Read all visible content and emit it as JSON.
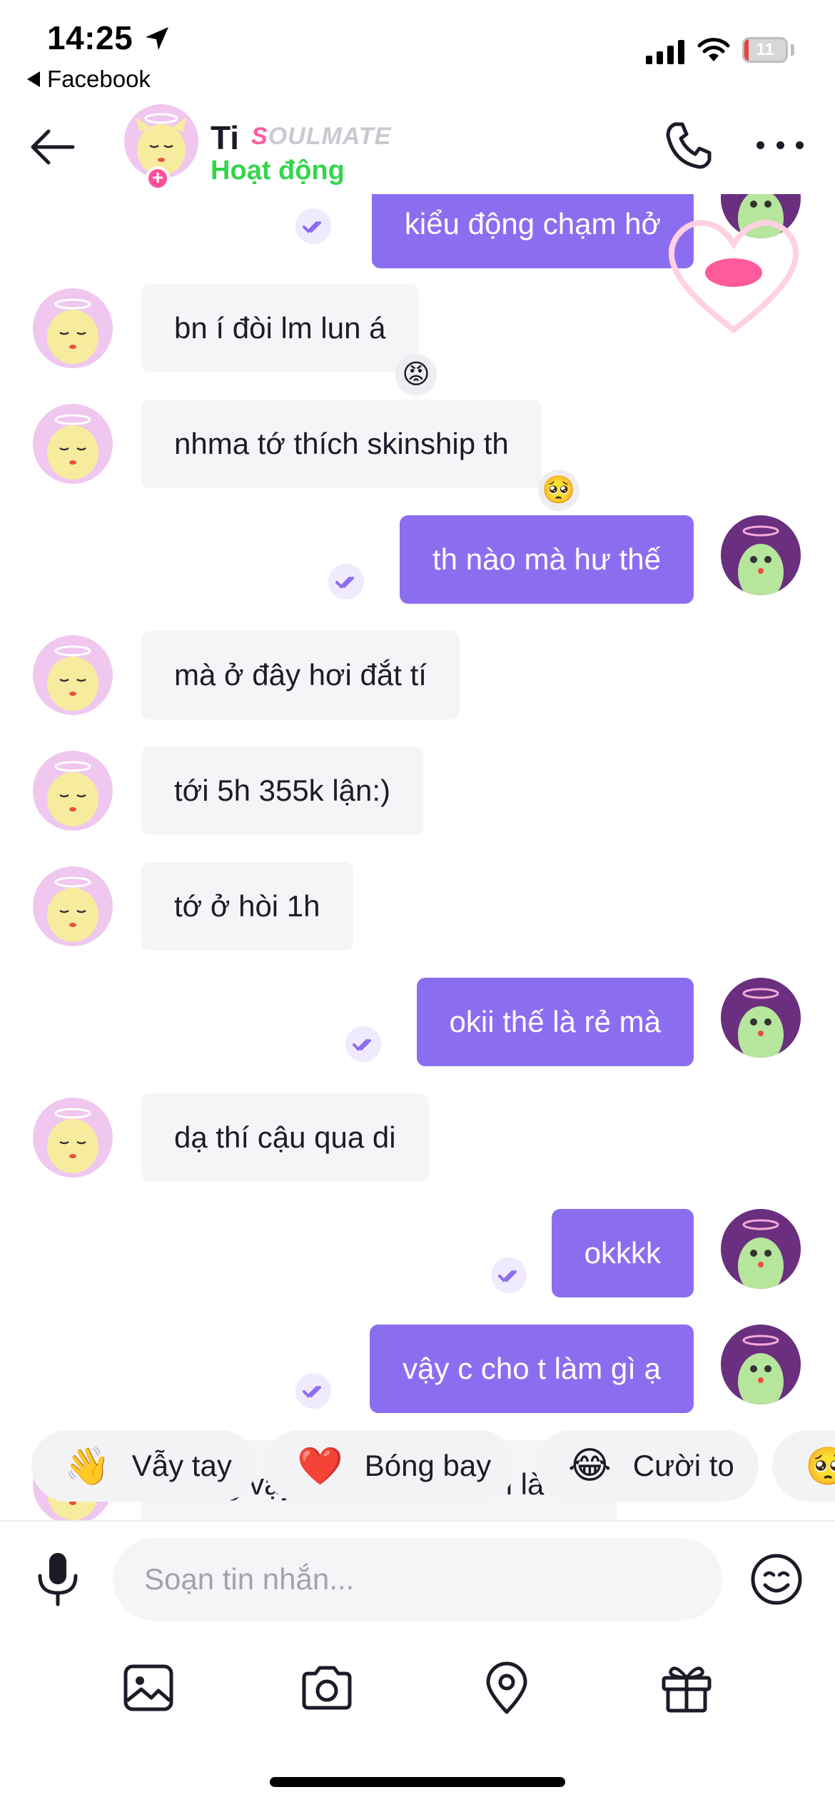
{
  "status_bar": {
    "time": "14:25",
    "back_app": "Facebook",
    "battery": "11"
  },
  "header": {
    "name": "Ti",
    "badge_first": "S",
    "badge_rest": "OULMATE",
    "status": "Hoạt động"
  },
  "messages": [
    {
      "side": "out",
      "text": "kiểu động chạm hở"
    },
    {
      "side": "in",
      "text": "bn í đòi lm lun á",
      "reaction": "😡"
    },
    {
      "side": "in",
      "text": "nhma tớ thích skinship th",
      "reaction": "🥺"
    },
    {
      "side": "out",
      "text": "th nào mà hư thế"
    },
    {
      "side": "in",
      "text": "mà ở đây hơi đắt tí"
    },
    {
      "side": "in",
      "text": "tới 5h 355k lận:)"
    },
    {
      "side": "in",
      "text": "tớ ở hòi 1h"
    },
    {
      "side": "out",
      "text": "okii thế là rẻ mà"
    },
    {
      "side": "in",
      "text": "dạ thí cậu qua di"
    },
    {
      "side": "out",
      "text": "okkkk"
    },
    {
      "side": "out",
      "text": "vậy c cho t làm gì ạ"
    },
    {
      "side": "in",
      "text": "nóng vậy khác pic có pốn là cn"
    }
  ],
  "quick_reactions": [
    {
      "emoji": "👋",
      "label": "Vẫy tay"
    },
    {
      "emoji": "❤️",
      "label": "Bóng bay"
    },
    {
      "emoji": "😂",
      "label": "Cười to"
    },
    {
      "emoji": "🥺",
      "label": ""
    }
  ],
  "composer": {
    "placeholder": "Soạn tin nhắn..."
  },
  "icons": [
    "back-arrow-icon",
    "phone-icon",
    "more-icon",
    "microphone-icon",
    "emoji-icon",
    "gallery-icon",
    "camera-icon",
    "location-icon",
    "gift-icon"
  ],
  "colors": {
    "outgoing": "#8b6ef0",
    "incoming": "#f5f5f8",
    "online": "#32d74b",
    "accent_pink": "#ff5a9a"
  }
}
